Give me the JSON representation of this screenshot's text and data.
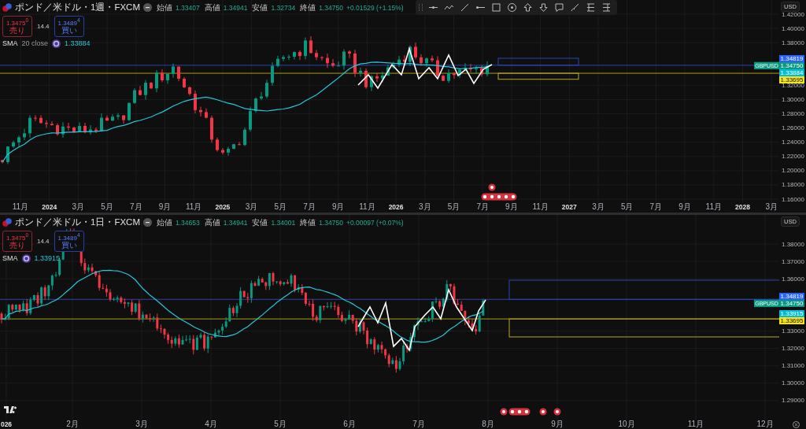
{
  "panes": [
    {
      "legend": {
        "symbol": "ポンド／米ドル・1週・FXCM",
        "ohlc": [
          {
            "label": "始値",
            "value": "1.33407"
          },
          {
            "label": "高値",
            "value": "1.34941"
          },
          {
            "label": "安値",
            "value": "1.32734"
          },
          {
            "label": "終値",
            "value": "1.34750"
          }
        ],
        "change": "+0.01529 (+1.15%)",
        "sell": {
          "price": "1.3475$^{0}$",
          "label": "売り"
        },
        "spread": "14.4",
        "buy": {
          "price": "1.3489$^{4}$",
          "label": "買い"
        },
        "indicator": {
          "name": "SMA",
          "params": "20 close",
          "value": "1.33884"
        }
      },
      "currency": "USD",
      "price_ticks": [
        "1.42000",
        "1.40000",
        "1.38000",
        "1.32000",
        "1.30000",
        "1.28000",
        "1.26000",
        "1.24000",
        "1.22000",
        "1.20000",
        "1.18000",
        "1.16000"
      ],
      "price_labels": [
        {
          "text": "1.34819",
          "color": "#2962ff"
        },
        {
          "text": "1.34750",
          "color": "#089981",
          "tag": "GBPUSD"
        },
        {
          "text": "1.33884",
          "color": "#00bcd4"
        },
        {
          "text": "1.33695",
          "color": "#f7e31b"
        }
      ],
      "time_ticks": [
        {
          "text": "11月",
          "kind": "month"
        },
        {
          "text": "2024",
          "kind": "year"
        },
        {
          "text": "3月",
          "kind": "month"
        },
        {
          "text": "5月",
          "kind": "month"
        },
        {
          "text": "7月",
          "kind": "month"
        },
        {
          "text": "9月",
          "kind": "month"
        },
        {
          "text": "11月",
          "kind": "month"
        },
        {
          "text": "2025",
          "kind": "year"
        },
        {
          "text": "3月",
          "kind": "month"
        },
        {
          "text": "5月",
          "kind": "month"
        },
        {
          "text": "7月",
          "kind": "month"
        },
        {
          "text": "9月",
          "kind": "month"
        },
        {
          "text": "11月",
          "kind": "month"
        },
        {
          "text": "2026",
          "kind": "year"
        },
        {
          "text": "3月",
          "kind": "month"
        },
        {
          "text": "5月",
          "kind": "month"
        },
        {
          "text": "7月",
          "kind": "month"
        },
        {
          "text": "9月",
          "kind": "month"
        },
        {
          "text": "11月",
          "kind": "month"
        },
        {
          "text": "2027",
          "kind": "year"
        },
        {
          "text": "3月",
          "kind": "month"
        },
        {
          "text": "5月",
          "kind": "month"
        },
        {
          "text": "7月",
          "kind": "month"
        },
        {
          "text": "9月",
          "kind": "month"
        },
        {
          "text": "11月",
          "kind": "month"
        },
        {
          "text": "2028",
          "kind": "year"
        },
        {
          "text": "3月",
          "kind": "month"
        }
      ]
    },
    {
      "legend": {
        "symbol": "ポンド／米ドル・1日・FXCM",
        "ohlc": [
          {
            "label": "始値",
            "value": "1.34653"
          },
          {
            "label": "高値",
            "value": "1.34941"
          },
          {
            "label": "安値",
            "value": "1.34001"
          },
          {
            "label": "終値",
            "value": "1.34750"
          }
        ],
        "change": "+0.00097 (+0.07%)",
        "sell": {
          "price": "1.3475$^{0}$",
          "label": "売り"
        },
        "spread": "14.4",
        "buy": {
          "price": "1.3489$^{4}$",
          "label": "買い"
        },
        "indicator": {
          "name": "SMA",
          "value": "1.33915"
        }
      },
      "currency": "USD",
      "price_ticks": [
        "1.38000",
        "1.37000",
        "1.36000",
        "1.33000",
        "1.32000",
        "1.31000",
        "1.30000",
        "1.29000"
      ],
      "price_labels": [
        {
          "text": "1.34819",
          "color": "#2962ff"
        },
        {
          "text": "1.34750",
          "color": "#089981",
          "tag": "GBPUSD"
        },
        {
          "text": "1.33915",
          "color": "#00bcd4"
        },
        {
          "text": "1.33695",
          "color": "#f7e31b"
        }
      ],
      "time_ticks": [
        {
          "text": "026",
          "kind": "year"
        },
        {
          "text": "2月",
          "kind": "month"
        },
        {
          "text": "3月",
          "kind": "month"
        },
        {
          "text": "4月",
          "kind": "month"
        },
        {
          "text": "5月",
          "kind": "month"
        },
        {
          "text": "6月",
          "kind": "month"
        },
        {
          "text": "7月",
          "kind": "month"
        },
        {
          "text": "8月",
          "kind": "month"
        },
        {
          "text": "9月",
          "kind": "month"
        },
        {
          "text": "10月",
          "kind": "month"
        },
        {
          "text": "11月",
          "kind": "month"
        },
        {
          "text": "12月",
          "kind": "month"
        }
      ]
    }
  ]
}
